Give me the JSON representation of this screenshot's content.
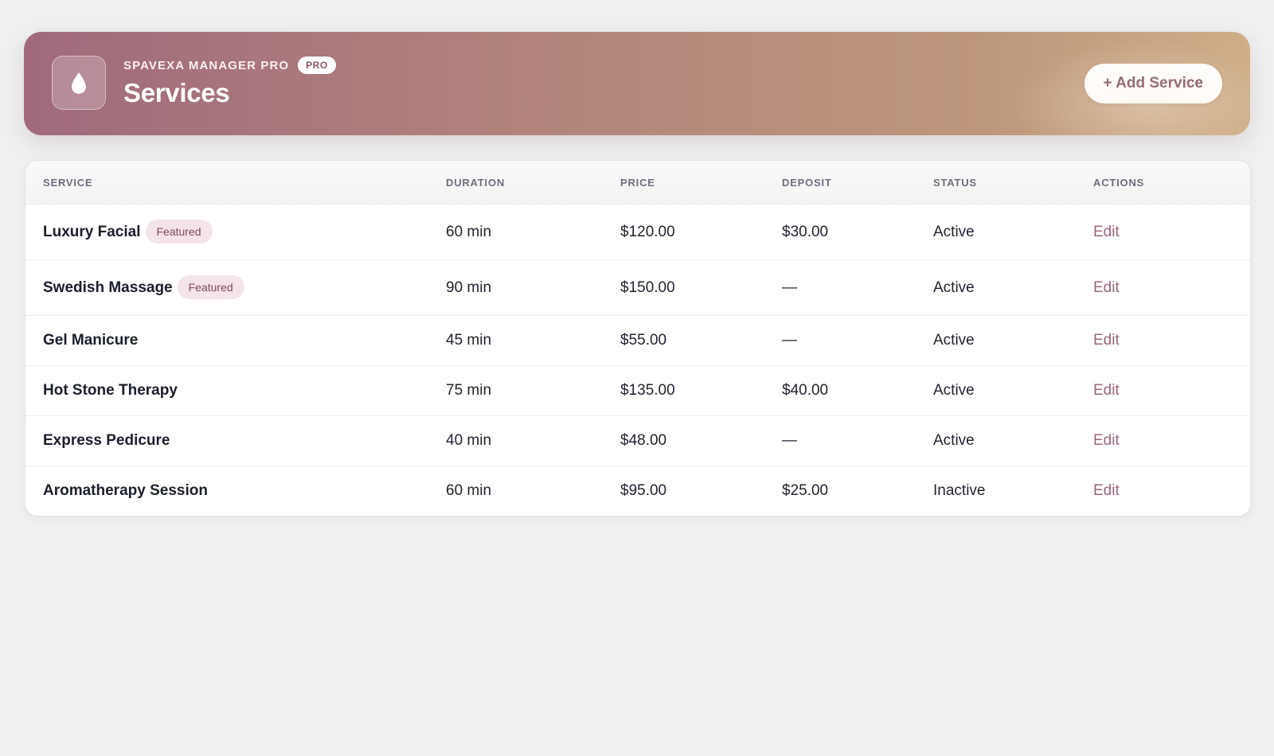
{
  "header": {
    "brand": "SPAVEXA MANAGER PRO",
    "badge": "PRO",
    "title": "Services",
    "add_button": "+ Add Service",
    "logo_icon": "droplet-icon"
  },
  "colors": {
    "accent": "#a06a7c",
    "accent_warm": "#cfae88",
    "link": "#9a6578",
    "badge_bg": "#f4e3e7"
  },
  "table": {
    "columns": [
      "SERVICE",
      "DURATION",
      "PRICE",
      "DEPOSIT",
      "STATUS",
      "ACTIONS"
    ],
    "rows": [
      {
        "name": "Luxury Facial",
        "featured": "Featured",
        "duration": "60 min",
        "price": "$120.00",
        "deposit": "$30.00",
        "status": "Active",
        "action": "Edit"
      },
      {
        "name": "Swedish Massage",
        "featured": "Featured",
        "duration": "90 min",
        "price": "$150.00",
        "deposit": "—",
        "status": "Active",
        "action": "Edit"
      },
      {
        "name": "Gel Manicure",
        "featured": "",
        "duration": "45 min",
        "price": "$55.00",
        "deposit": "—",
        "status": "Active",
        "action": "Edit"
      },
      {
        "name": "Hot Stone Therapy",
        "featured": "",
        "duration": "75 min",
        "price": "$135.00",
        "deposit": "$40.00",
        "status": "Active",
        "action": "Edit"
      },
      {
        "name": "Express Pedicure",
        "featured": "",
        "duration": "40 min",
        "price": "$48.00",
        "deposit": "—",
        "status": "Active",
        "action": "Edit"
      },
      {
        "name": "Aromatherapy Session",
        "featured": "",
        "duration": "60 min",
        "price": "$95.00",
        "deposit": "$25.00",
        "status": "Inactive",
        "action": "Edit"
      }
    ]
  }
}
